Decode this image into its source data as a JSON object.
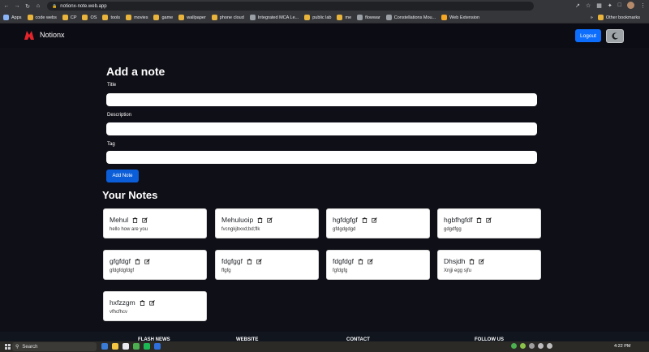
{
  "browser": {
    "url": "notionx-note.web.app",
    "bookmarks": [
      {
        "label": "Apps",
        "color": "#8ab4f8"
      },
      {
        "label": "code webs",
        "color": "#e8b43b"
      },
      {
        "label": "CP",
        "color": "#e8b43b"
      },
      {
        "label": "OS",
        "color": "#e8b43b"
      },
      {
        "label": "tools",
        "color": "#e8b43b"
      },
      {
        "label": "movies",
        "color": "#e8b43b"
      },
      {
        "label": "game",
        "color": "#e8b43b"
      },
      {
        "label": "wallpaper",
        "color": "#e8b43b"
      },
      {
        "label": "phone cloud",
        "color": "#e8b43b"
      },
      {
        "label": "Integrated MCA Le...",
        "color": "#9aa0a6"
      },
      {
        "label": "public lab",
        "color": "#e8b43b"
      },
      {
        "label": "me",
        "color": "#e8b43b"
      },
      {
        "label": "flowwar",
        "color": "#9aa0a6"
      },
      {
        "label": "Constellations Mou...",
        "color": "#9aa0a6"
      },
      {
        "label": "Web Extension",
        "color": "#f5a623"
      }
    ],
    "other_bookmarks": "Other bookmarks"
  },
  "navbar": {
    "brand": "Notionx",
    "logout_label": "Logout"
  },
  "form": {
    "title": "Add a note",
    "title_label": "Title",
    "description_label": "Description",
    "tag_label": "Tag",
    "title_value": "",
    "description_value": "",
    "tag_value": "",
    "add_label": "Add Note"
  },
  "notes": {
    "heading": "Your Notes",
    "items": [
      {
        "title": "Mehul",
        "description": "hello how are you"
      },
      {
        "title": "Mehuluoip",
        "description": "fvcngkjbxxd;bd;flk"
      },
      {
        "title": "hgfdgfgf",
        "description": "gfdgdgdgd"
      },
      {
        "title": "hgbfhgfdf",
        "description": "gdgdfgg"
      },
      {
        "title": "gfgfdgf",
        "description": "gfdgfdgfdgf"
      },
      {
        "title": "fdgfggf",
        "description": "ffgfg"
      },
      {
        "title": "fdgfdgf",
        "description": "fgfdgfg"
      },
      {
        "title": "Dhsjdh",
        "description": "Xnjji egg sjfu"
      },
      {
        "title": "hxfzzgm",
        "description": "vfhcfhcv"
      }
    ]
  },
  "footer": {
    "col1": "FLASH NEWS",
    "col2": "WEBSITE",
    "col3": "CONTACT",
    "col4": "FOLLOW US"
  },
  "taskbar": {
    "search_label": "Search",
    "time": "4:22 PM"
  }
}
